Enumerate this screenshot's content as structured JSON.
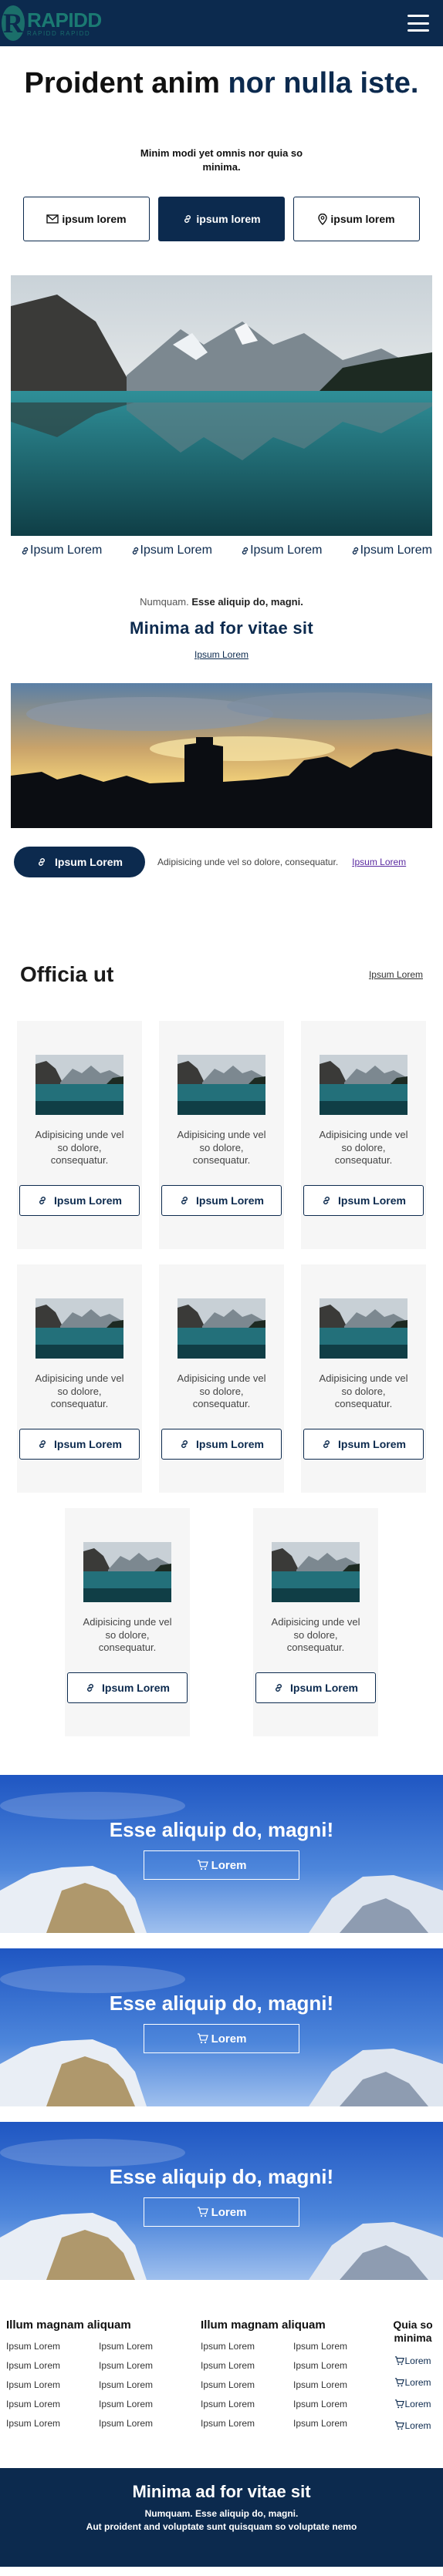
{
  "header": {
    "logo_letter": "R",
    "logo_name": "RAPIDD",
    "logo_tagline": "RAPIDD RAPIDD"
  },
  "hero": {
    "title_light": "Proident anim ",
    "title_bold": "nor nulla iste.",
    "subtitle": "Minim modi yet omnis nor quia so minima.",
    "buttons": [
      "ipsum lorem",
      "ipsum lorem",
      "ipsum lorem"
    ]
  },
  "links_row": [
    "Ipsum Lorem",
    "Ipsum Lorem",
    "Ipsum Lorem",
    "Ipsum Lorem"
  ],
  "mid": {
    "kicker_light": "Numquam.",
    "kicker_bold": " Esse aliquip do, magni.",
    "heading": "Minima ad for vitae sit",
    "link": "Ipsum Lorem"
  },
  "bar": {
    "button": "Ipsum Lorem",
    "text": "Adipisicing unde vel so dolore, consequatur.",
    "link": "Ipsum Lorem"
  },
  "cards_section": {
    "title": "Officia ut",
    "link": "Ipsum Lorem",
    "cards": [
      {
        "text": "Adipisicing unde vel so dolore, consequatur.",
        "button": "Ipsum Lorem"
      },
      {
        "text": "Adipisicing unde vel so dolore, consequatur.",
        "button": "Ipsum Lorem"
      },
      {
        "text": "Adipisicing unde vel so dolore, consequatur.",
        "button": "Ipsum Lorem"
      },
      {
        "text": "Adipisicing unde vel so dolore, consequatur.",
        "button": "Ipsum Lorem"
      },
      {
        "text": "Adipisicing unde vel so dolore, consequatur.",
        "button": "Ipsum Lorem"
      },
      {
        "text": "Adipisicing unde vel so dolore, consequatur.",
        "button": "Ipsum Lorem"
      },
      {
        "text": "Adipisicing unde vel so dolore, consequatur.",
        "button": "Ipsum Lorem"
      },
      {
        "text": "Adipisicing unde vel so dolore, consequatur.",
        "button": "Ipsum Lorem"
      }
    ]
  },
  "banners": [
    {
      "title": "Esse aliquip do, magni!",
      "button": "Lorem"
    },
    {
      "title": "Esse aliquip do, magni!",
      "button": "Lorem"
    },
    {
      "title": "Esse aliquip do, magni!",
      "button": "Lorem"
    }
  ],
  "footer": {
    "col1": {
      "title": "Illum magnam aliquam",
      "links": [
        "Ipsum Lorem",
        "Ipsum Lorem",
        "Ipsum Lorem",
        "Ipsum Lorem",
        "Ipsum Lorem",
        "Ipsum Lorem",
        "Ipsum Lorem",
        "Ipsum Lorem",
        "Ipsum Lorem",
        "Ipsum Lorem"
      ]
    },
    "col2": {
      "title": "Illum magnam aliquam",
      "links": [
        "Ipsum Lorem",
        "Ipsum Lorem",
        "Ipsum Lorem",
        "Ipsum Lorem",
        "Ipsum Lorem",
        "Ipsum Lorem",
        "Ipsum Lorem",
        "Ipsum Lorem",
        "Ipsum Lorem",
        "Ipsum Lorem"
      ]
    },
    "col3": {
      "title": "Quia so minima",
      "links": [
        "Lorem",
        "Lorem",
        "Lorem",
        "Lorem"
      ]
    }
  },
  "bottom": {
    "heading": "Minima ad for vitae sit",
    "line1": "Numquam. Esse aliquip do, magni.",
    "line2": "Aut proident and voluptate sunt quisquam so voluptate nemo"
  },
  "colors": {
    "primary": "#0c2a4e",
    "teal": "#1b7a72",
    "card_bg": "#f6f6f6",
    "link_purple": "#5a2aa0"
  }
}
